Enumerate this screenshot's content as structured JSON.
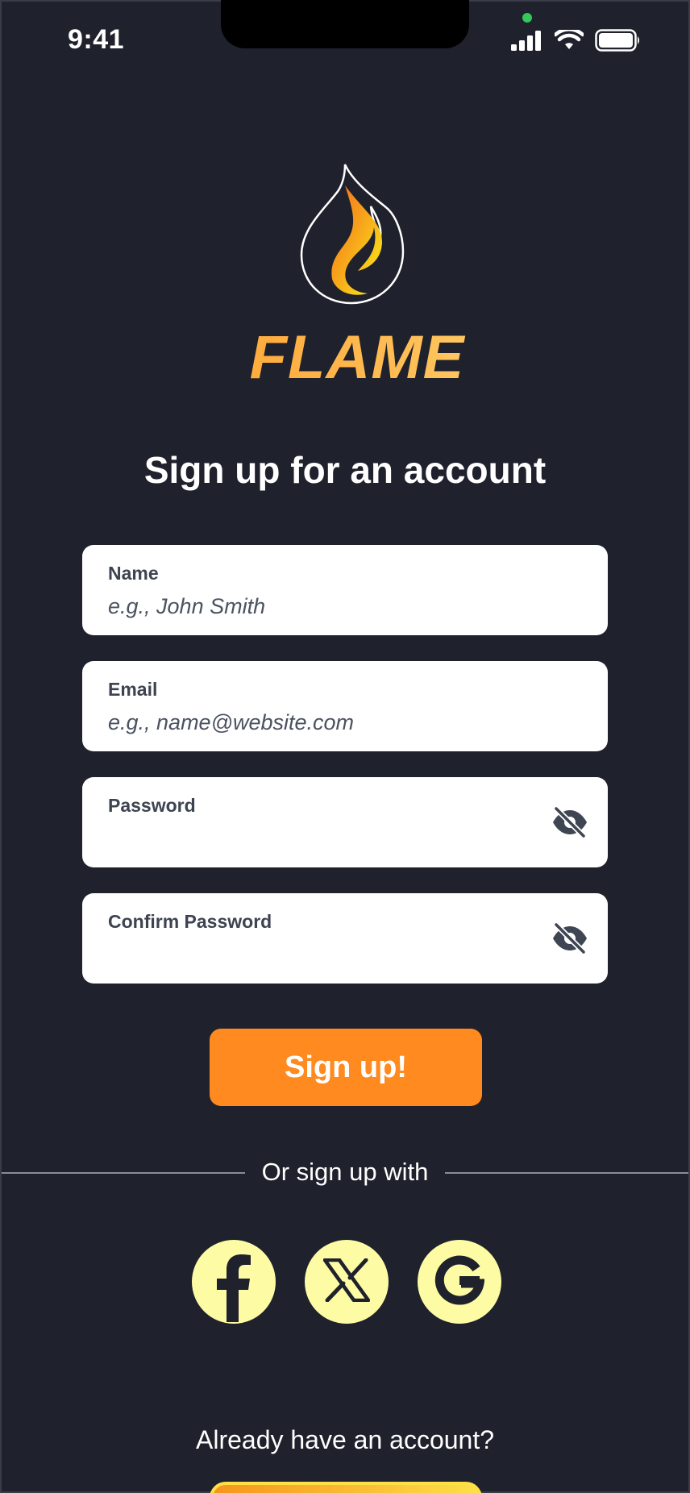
{
  "status_bar": {
    "time": "9:41",
    "icons": [
      "signal-icon",
      "wifi-icon",
      "battery-icon"
    ]
  },
  "brand": {
    "name": "FLAME",
    "logo_icon": "flame-logo-icon",
    "colors": {
      "orange": "#f7941d",
      "yellow": "#fde68a"
    }
  },
  "heading": "Sign up for an account",
  "form": {
    "name": {
      "label": "Name",
      "placeholder": "e.g., John Smith",
      "value": ""
    },
    "email": {
      "label": "Email",
      "placeholder": "e.g., name@website.com",
      "value": ""
    },
    "password": {
      "label": "Password",
      "value": "",
      "toggle_icon": "eye-off-icon"
    },
    "confirm_password": {
      "label": "Confirm Password",
      "value": "",
      "toggle_icon": "eye-off-icon"
    }
  },
  "signup_button": {
    "label": "Sign up!",
    "color": "#ff8a1f"
  },
  "divider_text": "Or sign up with",
  "social": [
    {
      "name": "facebook",
      "icon": "facebook-icon"
    },
    {
      "name": "x",
      "icon": "x-icon"
    },
    {
      "name": "google",
      "icon": "google-icon"
    }
  ],
  "social_bg_color": "#fdfca4",
  "footer": {
    "already_text": "Already have an account?"
  }
}
